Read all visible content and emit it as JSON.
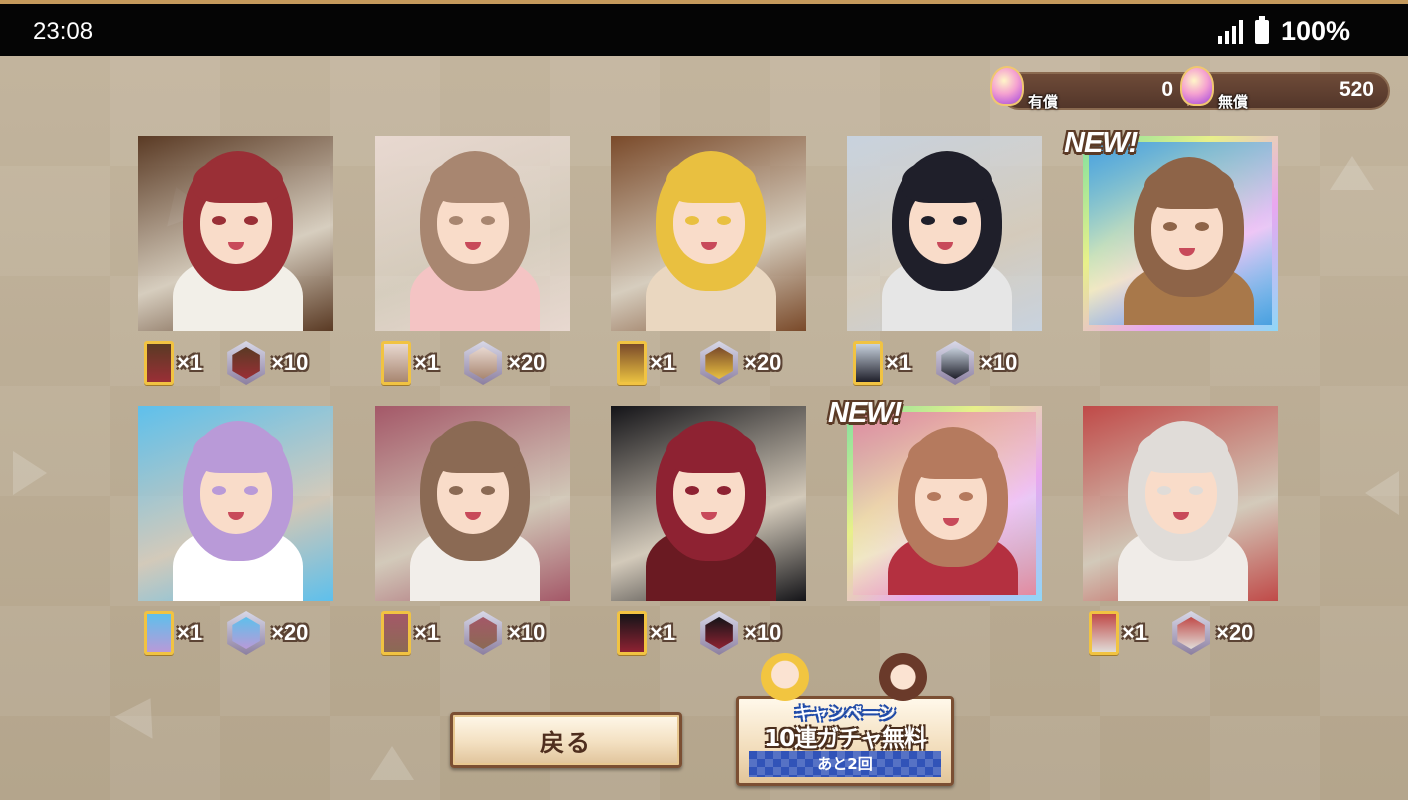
{
  "status_bar": {
    "time": "23:08",
    "battery": "100%"
  },
  "currency": {
    "paid": {
      "label": "有償",
      "value": "0"
    },
    "free": {
      "label": "無償",
      "value": "520"
    }
  },
  "new_label": "NEW!",
  "cards": [
    {
      "new": false,
      "ticket_qty": "×1",
      "shard_qty": "×10",
      "hair": "#9a2f36",
      "bg": "#5a3a24",
      "body": "#f2efe8"
    },
    {
      "new": false,
      "ticket_qty": "×1",
      "shard_qty": "×20",
      "hair": "#a88670",
      "bg": "#e8d8d0",
      "body": "#f4c4c4"
    },
    {
      "new": false,
      "ticket_qty": "×1",
      "shard_qty": "×20",
      "hair": "#e9c040",
      "bg": "#7a4a2a",
      "body": "#ead7c0"
    },
    {
      "new": false,
      "ticket_qty": "×1",
      "shard_qty": "×10",
      "hair": "#1f1f2a",
      "bg": "#c8d2de",
      "body": "#e6e6e6"
    },
    {
      "new": true,
      "ticket_qty": "",
      "shard_qty": "",
      "hair": "#8e6448",
      "bg": "#4aa0e0",
      "body": "#a8784a"
    },
    {
      "new": false,
      "ticket_qty": "×1",
      "shard_qty": "×20",
      "hair": "#b99ad8",
      "bg": "#5ec0ec",
      "body": "#ffffff"
    },
    {
      "new": false,
      "ticket_qty": "×1",
      "shard_qty": "×10",
      "hair": "#8b6a54",
      "bg": "#a45868",
      "body": "#f2eeea"
    },
    {
      "new": false,
      "ticket_qty": "×1",
      "shard_qty": "×10",
      "hair": "#8e2232",
      "bg": "#141418",
      "body": "#6a1a22"
    },
    {
      "new": true,
      "ticket_qty": "",
      "shard_qty": "",
      "hair": "#b57a5e",
      "bg": "#e48aa0",
      "body": "#b43040"
    },
    {
      "new": false,
      "ticket_qty": "×1",
      "shard_qty": "×20",
      "hair": "#e0dcd8",
      "bg": "#c04a48",
      "body": "#f0ece8"
    }
  ],
  "buttons": {
    "back": "戻る",
    "campaign_title": "キャンペーン",
    "campaign_main": "10連ガチャ無料",
    "campaign_remaining": "あと2回"
  },
  "colors": {
    "background": "#b9ab95",
    "frame_brown": "#7b4f33",
    "campaign_blue": "#3153b8"
  }
}
